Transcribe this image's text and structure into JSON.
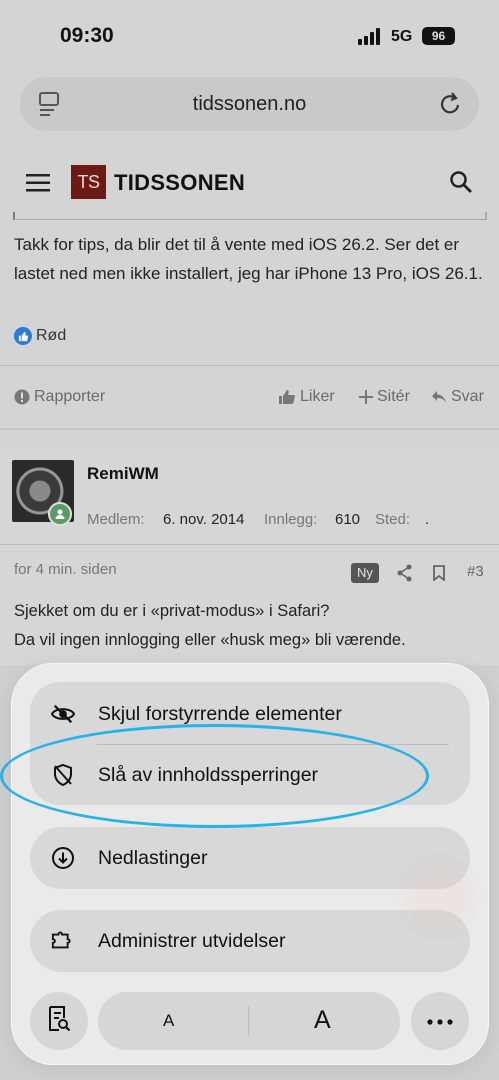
{
  "status_bar": {
    "time": "09:30",
    "network": "5G",
    "battery": "96"
  },
  "browser": {
    "url": "tidssonen.no"
  },
  "site": {
    "logo_mark": "TS",
    "logo_text": "TIDSSONEN"
  },
  "post1": {
    "text": "Takk for tips, da blir det til å vente med iOS 26.2. Ser det er lastet ned men ikke installert, jeg har iPhone 13 Pro, iOS 26.1.",
    "reaction_user": "Rød",
    "actions": {
      "report": "Rapporter",
      "like": "Liker",
      "quote": "Sitér",
      "reply": "Svar"
    }
  },
  "post2": {
    "username": "RemiWM",
    "member_label": "Medlem:",
    "member_value": "6. nov. 2014",
    "posts_label": "Innlegg:",
    "posts_value": "610",
    "place_label": "Sted:",
    "place_value": ".",
    "timestamp": "for 4 min. siden",
    "badge": "Ny",
    "post_number": "#3",
    "text_line1": "Sjekket om du er i «privat-modus» i Safari?",
    "text_line2": "Da vil ingen innlogging eller «husk meg» bli værende."
  },
  "menu": {
    "hide_distracting": "Skjul forstyrrende elementer",
    "disable_blockers": "Slå av innholdssperringer",
    "downloads": "Nedlastinger",
    "manage_extensions": "Administrer utvidelser",
    "font_small": "A",
    "font_large": "A"
  },
  "colors": {
    "highlight": "#27b3e6",
    "logo_bg": "#6b1a14",
    "online": "#5c9a66"
  }
}
